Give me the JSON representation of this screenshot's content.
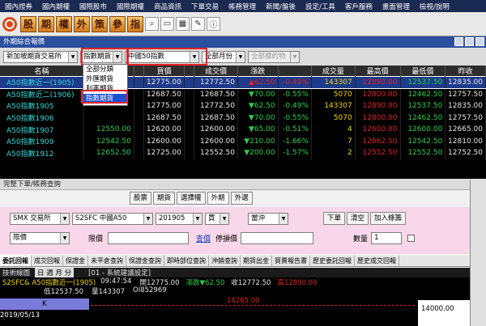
{
  "menu": [
    "國內證券",
    "國內期權",
    "國際股市",
    "國際期權",
    "商品資訊",
    "下單交易",
    "帳務管理",
    "新聞/盤後",
    "設定/工具",
    "客戶服務",
    "畫面管理",
    "檢視/說明"
  ],
  "toolbar": {
    "buttons": [
      "股",
      "期",
      "權",
      "外",
      "策",
      "參",
      "指"
    ],
    "icons": [
      "search-icon",
      "window-icon",
      "grid-icon",
      "chat-icon",
      "info-icon"
    ]
  },
  "quote_panel": {
    "title": "外期綜合報價",
    "filters": {
      "exchange": "新加坡期貨交易所",
      "type": "指數期貨",
      "product": "中國50指數",
      "month": "全部月份",
      "symbol": "全部標的物"
    },
    "dropdown": [
      "全部分類",
      "外匯期貨",
      "利率期貨",
      "指數期貨"
    ],
    "columns": [
      "名稱",
      "",
      "",
      "買價",
      "",
      "成交價",
      "漲跌",
      "",
      "成交量",
      "最高價",
      "最低價",
      "昨收"
    ],
    "rows": [
      {
        "name": "A50指數近一(1905)",
        "bid": "12775.00",
        "price": "12772.50",
        "arrow": "▲",
        "change": "62.50",
        "pct": "-0.49%",
        "vol": "143307",
        "high": "12890.00",
        "low": "12537.50",
        "prev": "12835.00"
      },
      {
        "name": "A50指數近二(1906)",
        "bid": "12687.50",
        "price": "12687.50",
        "arrow": "▼",
        "change": "70.00",
        "pct": "-0.55%",
        "vol": "5070",
        "high": "12800.00",
        "low": "12462.50",
        "prev": "12757.50"
      },
      {
        "name": "A50指數1905",
        "bid": "12775.00",
        "price": "12772.50",
        "arrow": "▼",
        "change": "62.50",
        "pct": "-0.49%",
        "vol": "143307",
        "high": "12890.00",
        "low": "12537.50",
        "prev": "12835.00"
      },
      {
        "name": "A50指數1906",
        "bid": "12687.50",
        "price": "12687.50",
        "arrow": "▼",
        "change": "70.00",
        "pct": "-0.55%",
        "vol": "5070",
        "high": "12800.00",
        "low": "12462.50",
        "prev": "12757.50"
      },
      {
        "name": "A50指數1907",
        "bid": "12620.00",
        "ask": "12550.00",
        "price": "12600.00",
        "arrow": "▼",
        "change": "65.00",
        "pct": "-0.51%",
        "vol": "4",
        "high": "12600.00",
        "low": "12600.00",
        "prev": "12665.00"
      },
      {
        "name": "A50指數1909",
        "bid": "12600.00",
        "ask": "12542.50",
        "price": "12600.00",
        "arrow": "▼",
        "change": "210.00",
        "pct": "-1.66%",
        "vol": "7",
        "high": "12662.50",
        "low": "12542.50",
        "prev": "12810.00"
      },
      {
        "name": "A50指數1912",
        "bid": "12725.00",
        "ask": "12652.50",
        "price": "12552.50",
        "arrow": "▼",
        "change": "200.00",
        "pct": "-1.57%",
        "vol": "2",
        "high": "12552.50",
        "low": "12552.50",
        "prev": "12752.50"
      }
    ]
  },
  "order_panel": {
    "title": "完整下單/帳務查詢",
    "tabs_top": [
      "股票",
      "期貨",
      "選擇權",
      "外期",
      "外選"
    ],
    "exchange": "SMX 交易所",
    "contract": "S2SFC 中國A50",
    "month": "201905",
    "side": "買",
    "type": "當沖",
    "order_type": "限價",
    "price_label": "限價",
    "query_link": "查價",
    "stop_label": "停損價",
    "qty_label": "數量",
    "qty_value": "1",
    "buttons": [
      "下單",
      "清空",
      "加入條籌"
    ],
    "tabs": [
      "委託回報",
      "成交回報",
      "保證金",
      "未平倉查詢",
      "保證金查詢",
      "即時部位查詢",
      "沖銷查詢",
      "期貨出金",
      "買賣報告書",
      "歷史委託回報",
      "歷史成交回報"
    ]
  },
  "chart": {
    "title": "技術線圖",
    "period": "日 週 月 分",
    "system": "[01 - 系統建議設定]",
    "symbol": "S2SFC& A50指數近一(1905)",
    "time": "09:47:54",
    "open": "開12775.00",
    "change": "漲跌▼62.50",
    "close": "收12772.50",
    "high": "高12890.00",
    "low": "低12537.50",
    "volume": "量143307",
    "oi": "OI852969",
    "level": "14265.00",
    "axis": "14000.00",
    "date": "2019/05/13",
    "k_label": "K"
  }
}
